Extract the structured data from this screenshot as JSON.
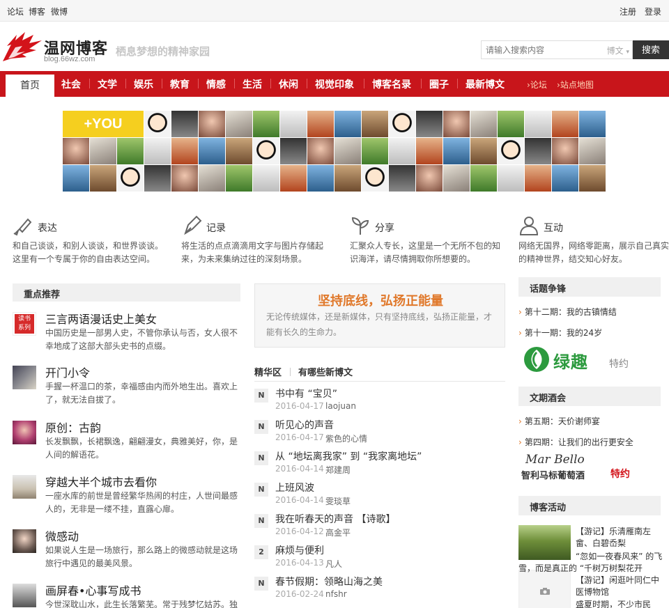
{
  "topbar": {
    "links": [
      "论坛",
      "博客",
      "微博"
    ],
    "register": "注册",
    "login": "登录"
  },
  "header": {
    "logo_text": "温网博客",
    "logo_url": "blog.66wz.com",
    "slogan": "栖息梦想的精神家园",
    "search_placeholder": "请输入搜索内容",
    "search_scope": "博文",
    "search_button": "搜索"
  },
  "nav": {
    "home": "首页",
    "items": [
      "社会",
      "文学",
      "娱乐",
      "教育",
      "情感",
      "生活",
      "休闲",
      "视觉印象",
      "博客名录",
      "圈子",
      "最新博文"
    ],
    "small_links": [
      "论坛",
      "站点地图"
    ]
  },
  "mosaic": {
    "you_label": "+YOU"
  },
  "features": [
    {
      "icon": "brush-icon",
      "title": "表达",
      "desc": "和自己谈谈，和别人谈谈，和世界谈谈。这里有一个专属于你的自由表达空间。"
    },
    {
      "icon": "pen-nib-icon",
      "title": "记录",
      "desc": "将生活的点点滴滴用文字与图片存储起来，为未来集纳过往的深刻场景。"
    },
    {
      "icon": "sprout-icon",
      "title": "分享",
      "desc": "汇聚众人专长，这里是一个无所不包的知识海洋，请尽情拥取你所想要的。"
    },
    {
      "icon": "people-icon",
      "title": "互动",
      "desc": "网络无国界，网络零距离，展示自己真实的精神世界，结交知心好友。"
    }
  ],
  "recommend": {
    "heading": "重点推荐",
    "items": [
      {
        "title": "三言两语漫话史上美女",
        "desc": "中国历史是一部男人史，不管你承认与否，女人很不幸地成了这部大部头史书的点缀。"
      },
      {
        "title": "开门小令",
        "desc": "手握一杯温口的茶，幸福感由内而外地生出。喜欢上了，就无法自拔了。"
      },
      {
        "title": "原创：古韵",
        "desc": "长发飘飘，长裙飘逸，翩翩漫女，典雅美好，你，是人间的解语花。"
      },
      {
        "title": "穿越大半个城市去看你",
        "desc": "一座水库的前世是曾经繁华热闹的村庄，人世间最感人的，无非是一缕不挂，直露心扉。"
      },
      {
        "title": "微感动",
        "desc": "如果说人生是一场旅行，那么路上的微感动就是这场旅行中遇见的最美风景。"
      },
      {
        "title": "画屏春•心事写成书",
        "desc": "今世深耽山水，此生长落繁芜。常于残梦忆姑苏。独"
      }
    ]
  },
  "slogan_box": {
    "title": "坚持底线，弘扬正能量",
    "desc": "无论传统媒体，还是新媒体，只有坚持底线，弘扬正能量，才能有长久的生命力。"
  },
  "mid_tabs": [
    "精华区",
    "有哪些新博文"
  ],
  "posts": [
    {
      "badge": "N",
      "title": "书中有 “宝贝”",
      "date": "2016-04-17",
      "author": "laojuan"
    },
    {
      "badge": "N",
      "title": "听见心的声音",
      "date": "2016-04-17",
      "author": "紫色的心情"
    },
    {
      "badge": "N",
      "title": "从 “地坛离我家” 到 “我家离地坛”",
      "date": "2016-04-14",
      "author": "郑建周"
    },
    {
      "badge": "N",
      "title": "上班风波",
      "date": "2016-04-14",
      "author": "雯琰草"
    },
    {
      "badge": "N",
      "title": "我在听春天的声音 【诗歌】",
      "date": "2016-04-12",
      "author": "高金平"
    },
    {
      "badge": "2",
      "title": "麻烦与便利",
      "date": "2016-04-13",
      "author": "凡人"
    },
    {
      "badge": "N",
      "title": "春节假期：领略山海之美",
      "date": "2016-02-24",
      "author": "nfshr"
    }
  ],
  "right": {
    "topic_heading": "话题争锋",
    "topics": [
      "第十二期：我的古镇情结",
      "第十一期：我的24岁"
    ],
    "ad1_text": "绿趣",
    "ad1_tag": "特约",
    "wine_heading": "文期酒会",
    "wines": [
      "第五期：天价谢师宴",
      "第四期：让我们的出行更安全"
    ],
    "ad2_brand": "Mar Bello",
    "ad2_text": "智利马标葡萄酒",
    "ad2_tag": "特约",
    "activity_heading": "博客活动",
    "activity1": "【游记】乐清雁南左畲、白碧岙梨",
    "activity1_more": "“忽如一夜春风来” 的飞雪，而是真正的 “千树万树梨花开",
    "activity2": "【游记】闲逛叶同仁中医博物馆",
    "activity2_more": "盛夏时期，不少市民"
  },
  "colors": {
    "nav_red": "#c8151b",
    "accent_orange": "#e0782a",
    "search_button": "#333333"
  }
}
